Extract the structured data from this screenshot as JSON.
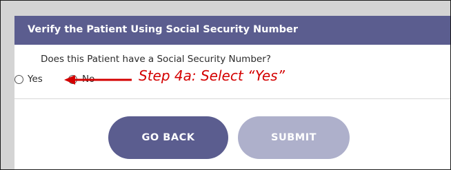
{
  "header": {
    "title": "Verify the Patient Using Social Security Number"
  },
  "form": {
    "question": "Does this Patient have a Social Security Number?",
    "options": [
      {
        "label": "Yes",
        "selected": false
      },
      {
        "label": "No",
        "selected": false
      }
    ]
  },
  "buttons": {
    "back_label": "GO BACK",
    "submit_label": "SUBMIT",
    "submit_enabled": false
  },
  "annotation": {
    "text": "Step 4a: Select “Yes”",
    "color": "#d40000"
  },
  "colors": {
    "header": "#5b5d8f",
    "primary_button": "#5b5d8f",
    "disabled_button": "#aeb0cb"
  }
}
